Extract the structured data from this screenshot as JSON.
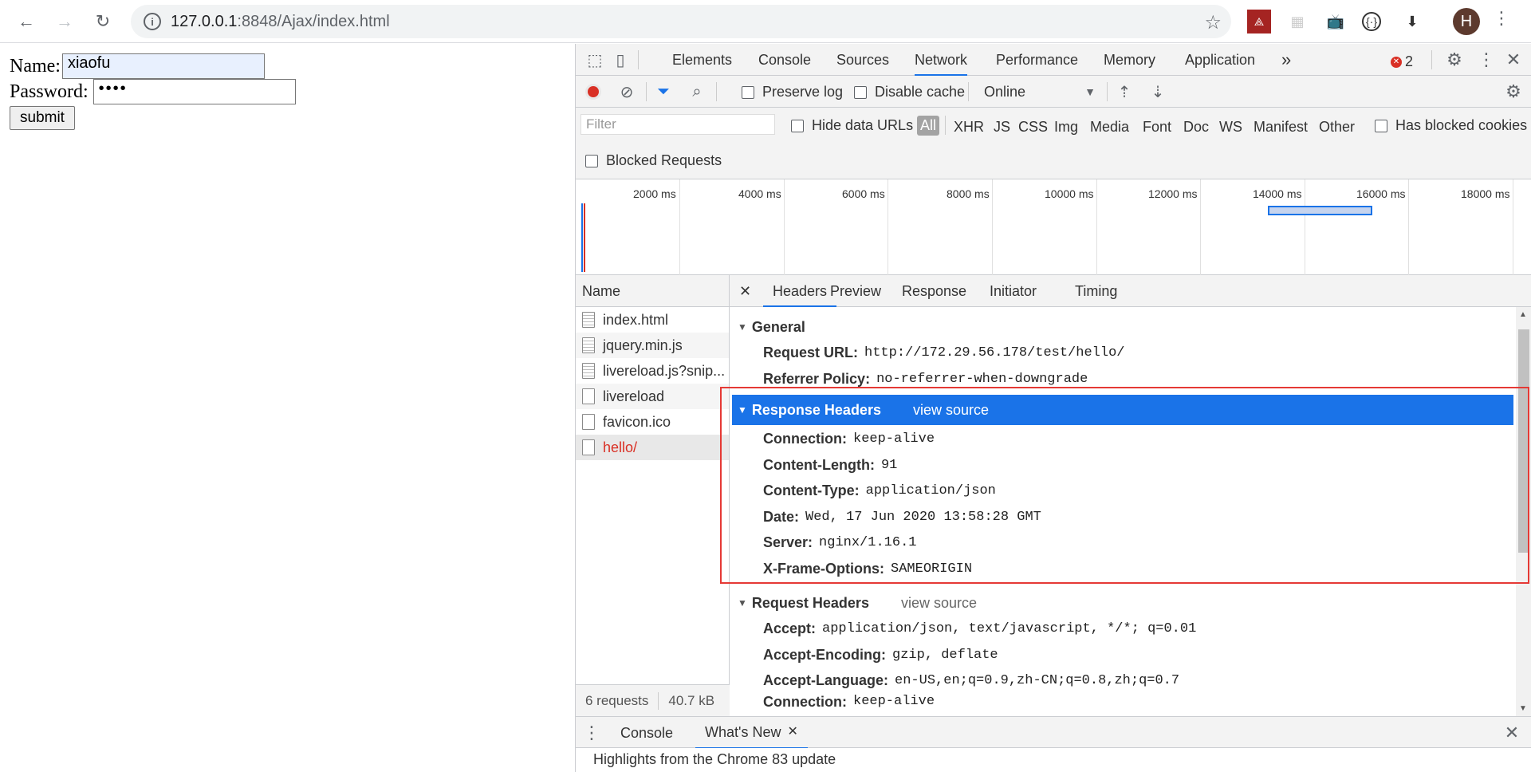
{
  "browser": {
    "url_host": "127.0.0.1",
    "url_rest": ":8848/Ajax/index.html",
    "avatar_letter": "H"
  },
  "page": {
    "name_label": "Name:",
    "name_value": "xiaofu",
    "password_label": "Password:",
    "password_value": "••••",
    "submit_label": "submit"
  },
  "devtools": {
    "tabs": [
      "Elements",
      "Console",
      "Sources",
      "Network",
      "Performance",
      "Memory",
      "Application"
    ],
    "active_tab": "Network",
    "more_tabs": "»",
    "error_count": "2",
    "toolbar": {
      "preserve_log": "Preserve log",
      "disable_cache": "Disable cache",
      "throttle": "Online"
    },
    "filter": {
      "placeholder": "Filter",
      "hide_data_urls": "Hide data URLs",
      "types": [
        "All",
        "XHR",
        "JS",
        "CSS",
        "Img",
        "Media",
        "Font",
        "Doc",
        "WS",
        "Manifest",
        "Other"
      ],
      "has_blocked_cookies": "Has blocked cookies",
      "blocked_requests": "Blocked Requests"
    },
    "timeline": {
      "ticks": [
        "2000 ms",
        "4000 ms",
        "6000 ms",
        "8000 ms",
        "10000 ms",
        "12000 ms",
        "14000 ms",
        "16000 ms",
        "18000 ms"
      ]
    },
    "requests": {
      "header": "Name",
      "items": [
        "index.html",
        "jquery.min.js",
        "livereload.js?snip...",
        "livereload",
        "favicon.ico",
        "hello/"
      ],
      "summary_count": "6 requests",
      "summary_size": "40.7 kB"
    },
    "detail_tabs": [
      "Headers",
      "Preview",
      "Response",
      "Initiator",
      "Timing"
    ],
    "general": {
      "title": "General",
      "request_url_key": "Request URL:",
      "request_url": "http://172.29.56.178/test/hello/",
      "referrer_key": "Referrer Policy:",
      "referrer": "no-referrer-when-downgrade"
    },
    "response_headers": {
      "title": "Response Headers",
      "view_source": "view source",
      "items": [
        {
          "k": "Connection:",
          "v": "keep-alive"
        },
        {
          "k": "Content-Length:",
          "v": "91"
        },
        {
          "k": "Content-Type:",
          "v": "application/json"
        },
        {
          "k": "Date:",
          "v": "Wed, 17 Jun 2020 13:58:28 GMT"
        },
        {
          "k": "Server:",
          "v": "nginx/1.16.1"
        },
        {
          "k": "X-Frame-Options:",
          "v": "SAMEORIGIN"
        }
      ]
    },
    "request_headers": {
      "title": "Request Headers",
      "view_source": "view source",
      "items": [
        {
          "k": "Accept:",
          "v": "application/json, text/javascript, */*; q=0.01"
        },
        {
          "k": "Accept-Encoding:",
          "v": "gzip, deflate"
        },
        {
          "k": "Accept-Language:",
          "v": "en-US,en;q=0.9,zh-CN;q=0.8,zh;q=0.7"
        },
        {
          "k": "Connection:",
          "v": "keep-alive"
        }
      ]
    },
    "drawer": {
      "tabs": [
        "Console",
        "What's New"
      ],
      "body": "Highlights from the Chrome 83 update"
    }
  }
}
